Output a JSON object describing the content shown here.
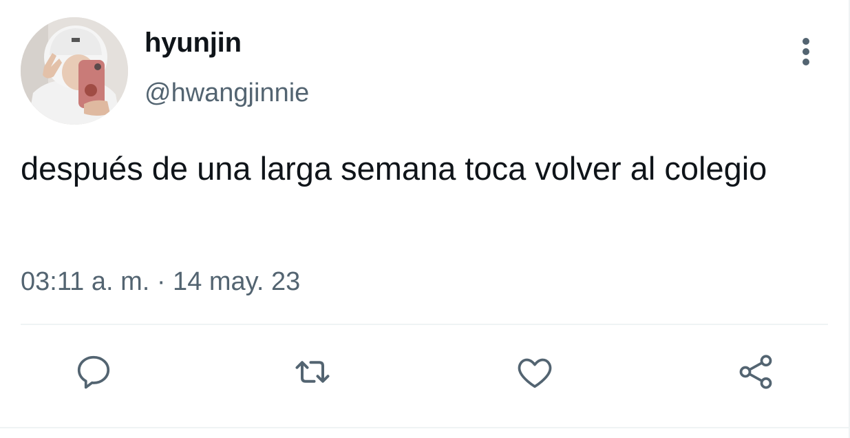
{
  "user": {
    "display_name": "hyunjin",
    "handle": "@hwangjinnie",
    "avatar": "profile-photo"
  },
  "tweet": {
    "text": "después de una larga semana toca volver al colegio",
    "timestamp": "03:11 a. m. · 14 may. 23"
  },
  "actions": {
    "reply_icon": "reply-icon",
    "retweet_icon": "retweet-icon",
    "like_icon": "heart-icon",
    "share_icon": "share-icon",
    "more_icon": "more-vertical-icon"
  },
  "colors": {
    "text": "#0f1419",
    "secondary": "#536471",
    "divider": "#eff3f4"
  }
}
